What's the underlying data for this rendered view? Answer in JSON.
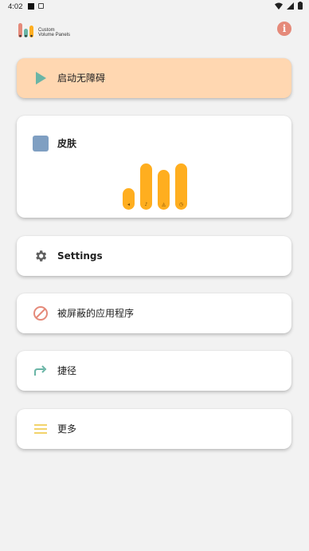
{
  "status_bar": {
    "time": "4:02"
  },
  "app": {
    "logo_line1": "Custom",
    "logo_line2": "Volume Panels",
    "info_icon": "i"
  },
  "menu": {
    "accessibility": {
      "label": "启动无障碍",
      "icon": "play-icon",
      "bg": "#ffd7b1",
      "icon_color": "#6ab5a6"
    },
    "skin": {
      "label": "皮肤",
      "icon_color": "#7f9fc2",
      "bar_color": "#ffae1f",
      "bar_levels": [
        0.46,
        1.0,
        0.86,
        1.0
      ]
    },
    "settings": {
      "label": "Settings",
      "icon": "gear-icon"
    },
    "blocked_apps": {
      "label": "被屏蔽的应用程序",
      "icon": "block-icon",
      "icon_color": "#e58a7a"
    },
    "shortcuts": {
      "label": "捷径",
      "icon": "redo-arrow-icon",
      "icon_color": "#6ab5a6"
    },
    "more": {
      "label": "更多",
      "icon": "menu-lines-icon",
      "icon_color": "#f2d36b"
    }
  }
}
